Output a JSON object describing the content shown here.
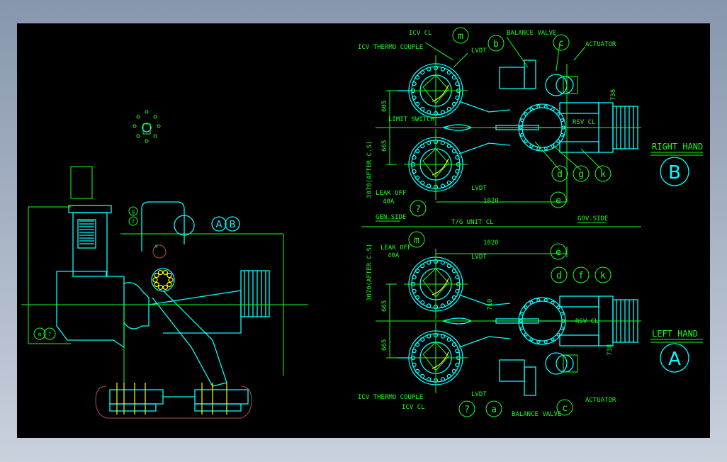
{
  "colors": {
    "background": "#000000",
    "line_green": "#19ff19",
    "line_cyan": "#00ffff",
    "line_yellow": "#ffff00",
    "line_red": "#b05050"
  },
  "elevation": {
    "view_marks": [
      "A",
      "B"
    ],
    "balloons": [
      "g",
      "f",
      "m",
      "?"
    ],
    "section_mark": "A"
  },
  "right_hand": {
    "title": "RIGHT HAND",
    "mark": "B",
    "labels": {
      "icv_cl": "ICV CL",
      "thermo": "ICV THERMO COUPLE",
      "lvdt_top": "LVDT",
      "balance": "BALANCE VALVE",
      "actuator": "ACTUATOR",
      "dim_738": "738",
      "dim_605": "605",
      "limit_switch": "LIMIT SWITCH",
      "rsv_cl": "RSV CL",
      "dim_665": "665",
      "dim_3070": "3070(AFTER C.S)",
      "leak_off": "LEAK OFF",
      "leak_size": "40A",
      "lvdt_bottom": "LVDT",
      "dim_1820": "1820"
    },
    "balloons": {
      "m": "m",
      "b": "b",
      "c": "c",
      "d": "d",
      "g": "g",
      "k": "k",
      "e": "e",
      "q": "?"
    }
  },
  "centerline": {
    "gen_side": "GEN.SIDE",
    "tg_unit": "T/G UNIT CL",
    "gov_side": "GOV.SIDE"
  },
  "left_hand": {
    "title": "LEFT HAND",
    "mark": "A",
    "labels": {
      "leak_off": "LEAK OFF",
      "leak_size": "40A",
      "lvdt_top": "LVDT",
      "dim_1820": "1820",
      "dim_3070": "3070(AFTER C.S)",
      "dim_665a": "665",
      "dim_710": "710",
      "dim_665b": "665",
      "rsv_cl": "RSV CL",
      "dim_738": "738",
      "thermo": "ICV THERMO COUPLE",
      "lvdt_bottom": "LVDT",
      "icv_cl": "ICV CL",
      "balance": "BALANCE VALVE",
      "actuator": "ACTUATOR"
    },
    "balloons": {
      "m": "m",
      "e": "e",
      "d": "d",
      "f": "f",
      "k": "k",
      "q": "?",
      "a": "a",
      "c": "c"
    }
  }
}
